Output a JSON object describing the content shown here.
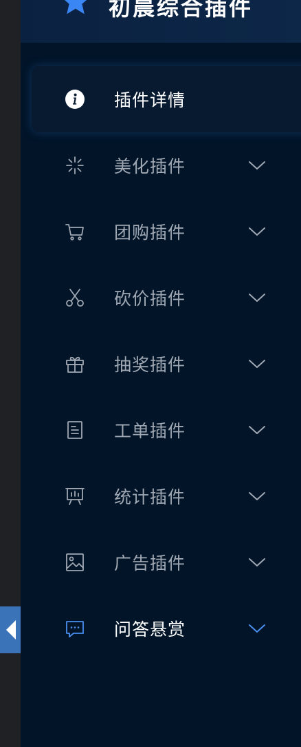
{
  "colors": {
    "sidebar_bg": "#011428",
    "header_bg": "#0b2141",
    "label": "#a0a8b3",
    "label_active": "#ffffff",
    "accent": "#4a8ef0",
    "handle": "#3a73b8"
  },
  "sidebar": {
    "title": "初晨综合插件",
    "logo_icon": "star-icon",
    "items": [
      {
        "label": "插件详情",
        "icon": "info-icon",
        "state": "active",
        "expandable": false
      },
      {
        "label": "美化插件",
        "icon": "sparkle-icon",
        "state": "collapsed",
        "expandable": true
      },
      {
        "label": "团购插件",
        "icon": "cart-icon",
        "state": "collapsed",
        "expandable": true
      },
      {
        "label": "砍价插件",
        "icon": "scissors-icon",
        "state": "collapsed",
        "expandable": true
      },
      {
        "label": "抽奖插件",
        "icon": "gift-icon",
        "state": "collapsed",
        "expandable": true
      },
      {
        "label": "工单插件",
        "icon": "document-icon",
        "state": "collapsed",
        "expandable": true
      },
      {
        "label": "统计插件",
        "icon": "presentation-icon",
        "state": "collapsed",
        "expandable": true
      },
      {
        "label": "广告插件",
        "icon": "image-icon",
        "state": "collapsed",
        "expandable": true
      },
      {
        "label": "问答悬赏",
        "icon": "chat-icon",
        "state": "open",
        "expandable": true
      }
    ]
  }
}
